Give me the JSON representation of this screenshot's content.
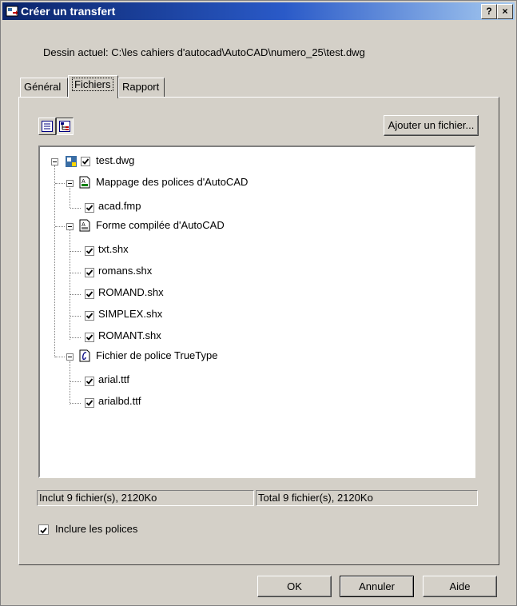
{
  "window": {
    "title": "Créer un transfert",
    "help_label": "?",
    "close_label": "×"
  },
  "header": {
    "dessin": "Dessin actuel: C:\\les cahiers d'autocad\\AutoCAD\\numero_25\\test.dwg"
  },
  "tabs": [
    {
      "label": "Général"
    },
    {
      "label": "Fichiers",
      "active": true
    },
    {
      "label": "Rapport"
    }
  ],
  "toolbar": {
    "add_file_label": "Ajouter un fichier..."
  },
  "tree": {
    "root": "test.dwg",
    "groups": [
      {
        "label": "Mappage des polices d'AutoCAD",
        "icon": "fmp-icon",
        "files": [
          "acad.fmp"
        ]
      },
      {
        "label": "Forme compilée d'AutoCAD",
        "icon": "shx-icon",
        "files": [
          "txt.shx",
          "romans.shx",
          "ROMAND.shx",
          "SIMPLEX.shx",
          "ROMANT.shx"
        ]
      },
      {
        "label": "Fichier de police TrueType",
        "icon": "truetype-icon",
        "files": [
          "arial.ttf",
          "arialbd.ttf"
        ]
      }
    ]
  },
  "status": {
    "included": "Inclut 9 fichier(s), 2120Ko",
    "total": "Total 9 fichier(s), 2120Ko"
  },
  "options": {
    "include_fonts_label": "Inclure les polices",
    "include_fonts_checked": true
  },
  "buttons": {
    "ok": "OK",
    "cancel": "Annuler",
    "help": "Aide"
  }
}
